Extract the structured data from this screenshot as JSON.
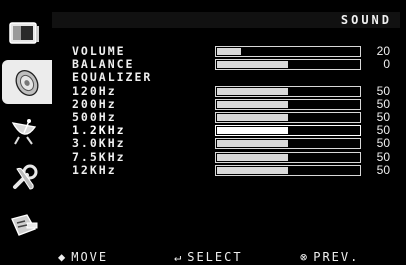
{
  "header": {
    "title": "SOUND"
  },
  "sidebar": {
    "icons": [
      {
        "name": "picture-icon"
      },
      {
        "name": "sound-icon"
      },
      {
        "name": "satellite-icon"
      },
      {
        "name": "setup-icon"
      },
      {
        "name": "input-icon"
      }
    ],
    "active_index": 1
  },
  "menu": {
    "items": [
      {
        "label": "VOLUME",
        "value": "20",
        "level": 0.17,
        "has_bar": true
      },
      {
        "label": "BALANCE",
        "value": "0",
        "level": 0.5,
        "has_bar": true
      },
      {
        "label": "EQUALIZER",
        "value": "",
        "level": null,
        "has_bar": false
      },
      {
        "label": "120Hz",
        "value": "50",
        "level": 0.5,
        "has_bar": true
      },
      {
        "label": "200Hz",
        "value": "50",
        "level": 0.5,
        "has_bar": true
      },
      {
        "label": "500Hz",
        "value": "50",
        "level": 0.5,
        "has_bar": true
      },
      {
        "label": "1.2KHz",
        "value": "50",
        "level": 0.5,
        "has_bar": true,
        "selected": true
      },
      {
        "label": "3.0KHz",
        "value": "50",
        "level": 0.5,
        "has_bar": true
      },
      {
        "label": "7.5KHz",
        "value": "50",
        "level": 0.5,
        "has_bar": true
      },
      {
        "label": "12KHz",
        "value": "50",
        "level": 0.5,
        "has_bar": true
      }
    ]
  },
  "footer": {
    "move": {
      "glyph": "◆",
      "label": "MOVE"
    },
    "select": {
      "glyph": "↵",
      "label": "SELECT"
    },
    "prev": {
      "glyph": "⊗",
      "label": "PREV."
    }
  }
}
